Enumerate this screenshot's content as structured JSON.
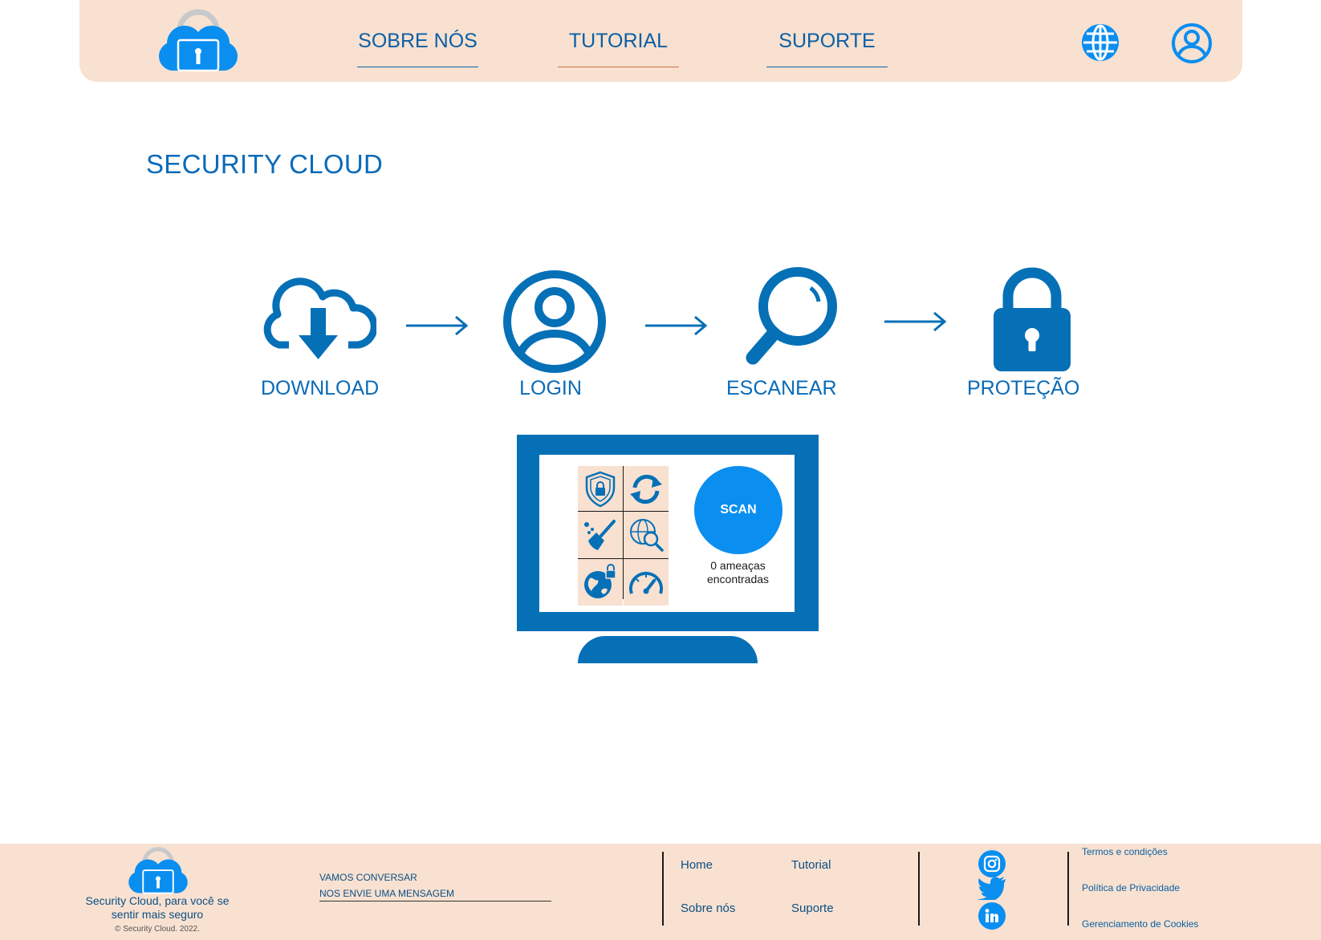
{
  "header": {
    "nav": [
      {
        "label": "SOBRE NÓS"
      },
      {
        "label": "TUTORIAL",
        "active": true
      },
      {
        "label": "SUPORTE"
      }
    ],
    "icons": {
      "logo": "cloud-lock-logo",
      "language": "globe-icon",
      "account": "user-icon"
    }
  },
  "main": {
    "title": "SECURITY CLOUD",
    "steps": [
      {
        "label": "DOWNLOAD",
        "icon": "cloud-download-icon"
      },
      {
        "label": "LOGIN",
        "icon": "user-circle-icon"
      },
      {
        "label": "ESCANEAR",
        "icon": "magnifier-icon"
      },
      {
        "label": "PROTEÇÃO",
        "icon": "padlock-icon"
      }
    ],
    "monitor": {
      "tools": [
        "shield-lock-icon",
        "sync-icon",
        "cleanup-broom-icon",
        "web-search-icon",
        "secure-globe-icon",
        "speedometer-icon"
      ],
      "scan_label": "SCAN",
      "status": "0 ameaças encontradas"
    }
  },
  "footer": {
    "tagline": "Security Cloud, para você se sentir mais seguro",
    "copyright": "© Security Cloud. 2022.",
    "contact": {
      "heading": "VAMOS CONVERSAR",
      "cta": "NOS ENVIE UMA MENSAGEM"
    },
    "links": [
      "Home",
      "Tutorial",
      "Sobre nós",
      "Suporte"
    ],
    "social": [
      "instagram-icon",
      "twitter-icon",
      "linkedin-icon"
    ],
    "legal": [
      "Termos e condições",
      "Política de Privacidade",
      "Gerenciamento de Cookies"
    ]
  },
  "colors": {
    "accent": "#0a8ef0",
    "primary": "#0670b7",
    "peach": "#f8e1d0",
    "active_underline": "#c9704b"
  }
}
